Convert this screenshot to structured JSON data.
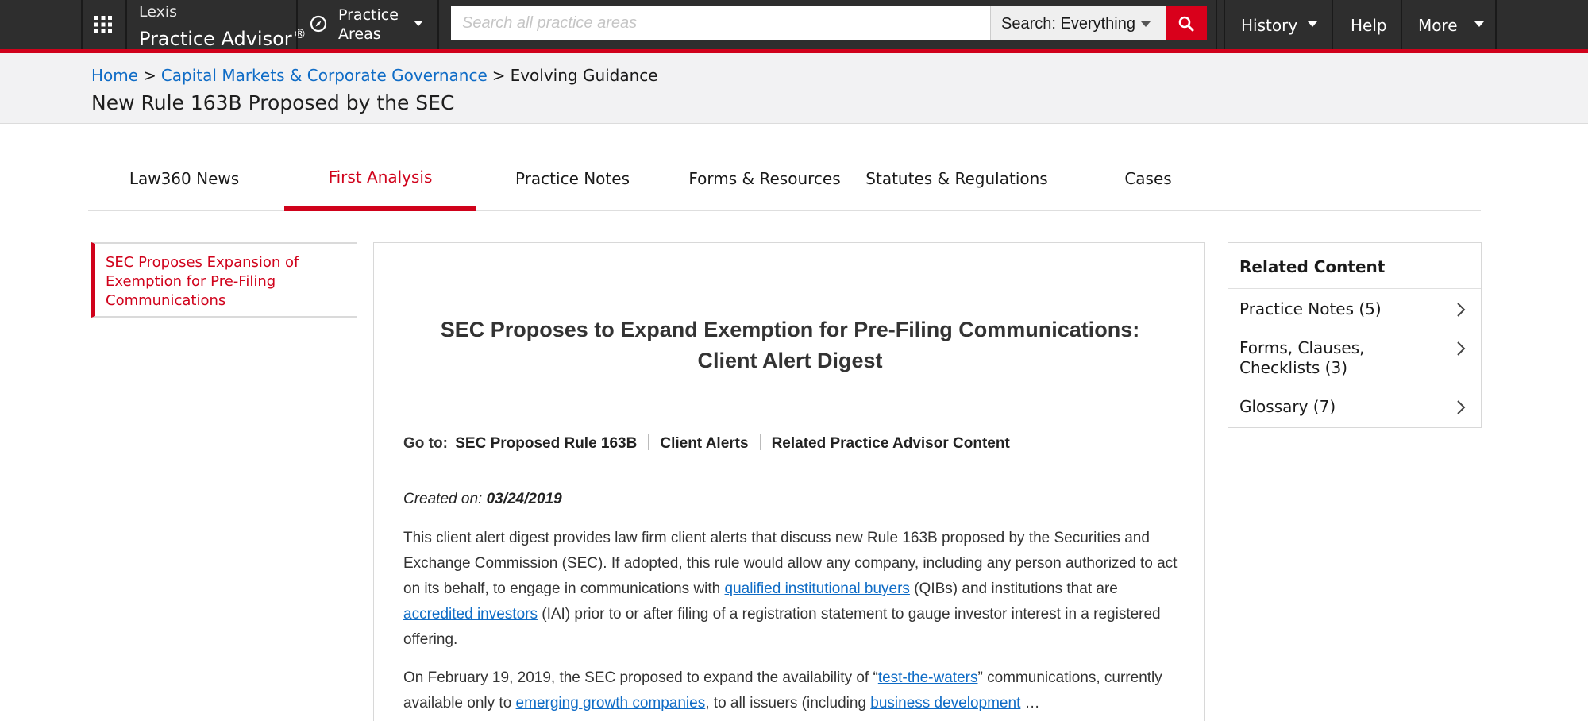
{
  "app": {
    "brand_line1": "Lexis",
    "brand_line2": "Practice Advisor",
    "brand_reg": "®",
    "practice_areas_line1": "Practice",
    "practice_areas_line2": "Areas",
    "search_placeholder": "Search all practice areas",
    "search_scope": "Search: Everything",
    "nav": {
      "history": "History",
      "help": "Help",
      "more": "More"
    }
  },
  "breadcrumb": {
    "home": "Home",
    "sep1": ">",
    "section": "Capital Markets & Corporate Governance",
    "sep2": ">",
    "current": "Evolving Guidance"
  },
  "page_title": "New Rule 163B Proposed by the SEC",
  "tabs": [
    {
      "label": "Law360 News"
    },
    {
      "label": "First Analysis"
    },
    {
      "label": "Practice Notes"
    },
    {
      "label": "Forms & Resources"
    },
    {
      "label": "Statutes & Regulations"
    },
    {
      "label": "Cases"
    }
  ],
  "toc": {
    "item": "SEC Proposes Expansion of Exemption for Pre-Filing Communications"
  },
  "document": {
    "title_line1": "SEC Proposes to Expand Exemption for Pre-Filing Communications:",
    "title_line2": "Client Alert Digest",
    "goto_label": "Go to:",
    "goto_links": [
      "SEC Proposed Rule 163B",
      "Client Alerts",
      "Related Practice Advisor Content"
    ],
    "created_label": "Created on:",
    "created_date": "03/24/2019",
    "p1": {
      "a": "This client alert digest provides law firm client alerts that discuss new Rule 163B proposed by the Securities and Exchange Commission (SEC). If adopted, this rule would allow any company, including any person authorized to act on its behalf, to engage in communications with ",
      "link1": "qualified institutional buyers",
      "b": " (QIBs) and institutions that are ",
      "link2": "accredited investors",
      "c": " (IAI) prior to or after filing of a registration statement to gauge investor interest in a registered offering."
    },
    "p2": {
      "a": "On February 19, 2019, the SEC proposed to expand the availability of “",
      "link1": "test-the-waters",
      "b": "” communications, currently available only to ",
      "link2": "emerging growth companies",
      "c": ", to all issuers (including ",
      "link3": "business development",
      "d": " …"
    }
  },
  "related": {
    "heading": "Related Content",
    "items": [
      {
        "label": "Practice Notes (5)"
      },
      {
        "label": "Forms, Clauses, Checklists (3)"
      },
      {
        "label": "Glossary (7)"
      }
    ]
  },
  "colors": {
    "accent_red": "#d0021b",
    "link_blue": "#0f6cc6",
    "topbar": "#2e2e2e"
  },
  "icons": [
    "apps-grid-icon",
    "compass-icon",
    "search-icon",
    "chevron-right-icon",
    "caret-down-icon"
  ]
}
